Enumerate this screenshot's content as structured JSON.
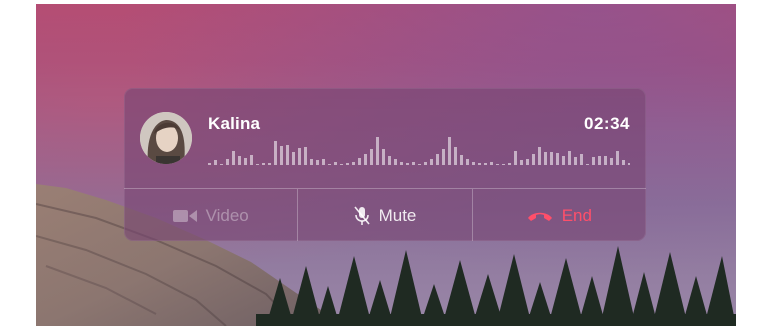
{
  "call": {
    "caller_name": "Kalina",
    "duration": "02:34",
    "waveform_levels": [
      2,
      5,
      1,
      6,
      14,
      9,
      7,
      10,
      1,
      2,
      2,
      24,
      19,
      20,
      13,
      17,
      18,
      6,
      5,
      6,
      1,
      3,
      1,
      2,
      3,
      7,
      11,
      16,
      28,
      16,
      9,
      6,
      3,
      2,
      3,
      1,
      3,
      6,
      11,
      16,
      28,
      18,
      10,
      6,
      3,
      2,
      2,
      3,
      1,
      1,
      2,
      14,
      5,
      6,
      11,
      18,
      13,
      13,
      12,
      9,
      14,
      8,
      11,
      1,
      8,
      9,
      9,
      7,
      14,
      5,
      2
    ]
  },
  "controls": {
    "video": {
      "label": "Video",
      "icon": "video-camera-icon",
      "enabled": false
    },
    "mute": {
      "label": "Mute",
      "icon": "microphone-muted-icon",
      "enabled": true
    },
    "end": {
      "label": "End",
      "icon": "phone-hangup-icon",
      "color": "#ff4f6a"
    }
  }
}
